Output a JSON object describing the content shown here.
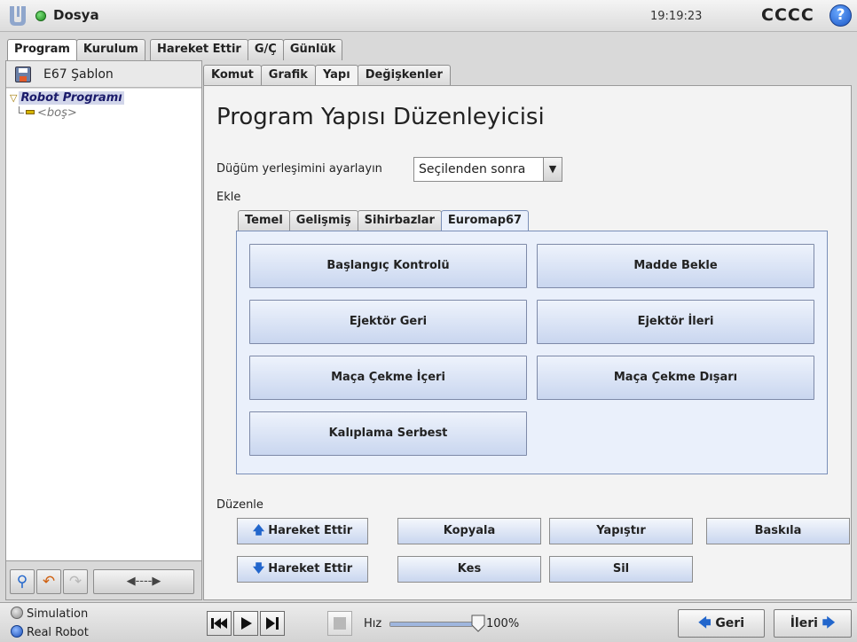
{
  "titlebar": {
    "menu_label": "Dosya",
    "time": "19:19:23",
    "robot_name": "CCCC",
    "help_glyph": "?"
  },
  "main_tabs": [
    "Program",
    "Kurulum",
    "Hareket Ettir",
    "G/Ç",
    "Günlük"
  ],
  "left_panel": {
    "program_file": "E67 Şablon",
    "tree": {
      "root": "Robot Programı",
      "child": "<boş>"
    },
    "toolbar": {
      "search_glyph": "⚲",
      "undo_glyph": "↶",
      "redo_glyph": "↷",
      "nav_glyph": "◀----▶"
    }
  },
  "sub_tabs": [
    "Komut",
    "Grafik",
    "Yapı",
    "Değişkenler"
  ],
  "editor": {
    "title": "Program Yapısı Düzenleyicisi",
    "node_label": "Düğüm yerleşimini ayarlayın",
    "node_select_value": "Seçilenden sonra",
    "add_label": "Ekle",
    "insert_tabs": [
      "Temel",
      "Gelişmiş",
      "Sihirbazlar",
      "Euromap67"
    ],
    "euromap_buttons": [
      "Başlangıç Kontrolü",
      "Madde Bekle",
      "Ejektör Geri",
      "Ejektör İleri",
      "Maça Çekme İçeri",
      "Maça Çekme Dışarı",
      "Kalıplama Serbest"
    ],
    "edit_label": "Düzenle",
    "edit_buttons": {
      "move_up": "Hareket Ettir",
      "copy": "Kopyala",
      "paste": "Yapıştır",
      "suppress": "Baskıla",
      "move_down": "Hareket Ettir",
      "cut": "Kes",
      "delete": "Sil"
    }
  },
  "bottom": {
    "simulation": "Simulation",
    "real_robot": "Real Robot",
    "speed_label": "Hız",
    "speed_value": "100%",
    "speed_fraction": 1.0,
    "back": "Geri",
    "next": "İleri"
  },
  "colors": {
    "status_ok": "#1e8a1e",
    "accent_blue": "#2266cc",
    "button_blue_top": "#eef3fc",
    "button_blue_bottom": "#c9d6ef"
  }
}
